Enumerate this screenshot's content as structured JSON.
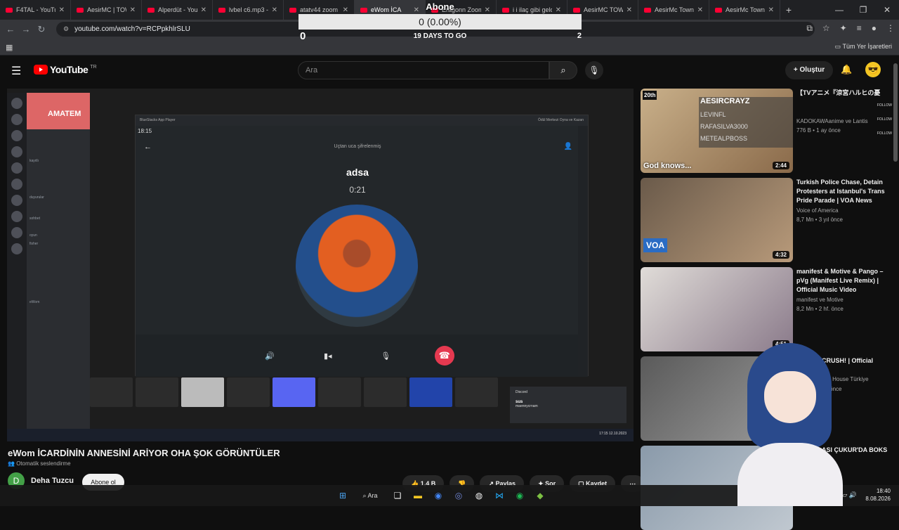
{
  "browser": {
    "tabs": [
      {
        "title": "F4TAL - YouTu"
      },
      {
        "title": "AesirMC | TOW"
      },
      {
        "title": "Alperdüt - You"
      },
      {
        "title": "lvbel c6.mp3 -"
      },
      {
        "title": "atatv44 zoom"
      },
      {
        "title": "eWom İCA"
      },
      {
        "title": "Eragonn Zoom"
      },
      {
        "title": "i i ilaç gibi gelo"
      },
      {
        "title": "AesirMC TOW"
      },
      {
        "title": "AesirMc Towny"
      },
      {
        "title": "AesirMc Towny"
      }
    ],
    "url": "youtube.com/watch?v=RCPpkhlrSLU",
    "bookmarks_label": "Tüm Yer İşaretleri"
  },
  "overlay": {
    "title": "Abone",
    "progress": "0 (0.00%)",
    "left_count": "0",
    "middle": "19 DAYS TO GO",
    "right_count": "2"
  },
  "youtube": {
    "brand": "YouTube",
    "region": "TR",
    "search_placeholder": "Ara",
    "create_label": "Oluştur"
  },
  "player": {
    "discord_banner": "AMATEM",
    "discord_channels": [
      "kayıtlı",
      "duyurular",
      "sohbet",
      "oyun",
      "fisher",
      "eWom"
    ],
    "bluestacks_title": "BlueStacks App Player",
    "bluestacks_right": "Ödül Merkezi   Oyna ve Kazan",
    "call_time": "18:15",
    "call_e2e": "Uçtan uca şifrelenmiş",
    "call_name": "adsa",
    "call_duration": "0:21",
    "toast_app": "Discord",
    "toast_title": "sus",
    "toast_sub": "maennycrnam",
    "clock": "17:15",
    "date": "12.10.2023"
  },
  "video": {
    "title": "eWom İCARDİNİN ANNESİNİ ARİYOR OHA ŞOK GÖRÜNTÜLER",
    "autodub": "Otomatik seslendirme",
    "channel_initial": "D",
    "channel": "Deha Tuzcu",
    "subscribe_label": "Abone ol",
    "likes": "1,4 B",
    "share_label": "Paylaş",
    "ask_label": "Sor",
    "save_label": "Kaydet"
  },
  "sidebar": {
    "cards": [
      {
        "title": "【TVアニメ『涼宮ハルヒの憂",
        "channel": "KADOKAWAanime ve Lantis",
        "meta": "776 B • 1 ay önce",
        "duration": "2:44",
        "thumb_caption": "God knows...",
        "badge": "20th"
      },
      {
        "title": "Turkish Police Chase, Detain Protesters at Istanbul's Trans Pride Parade | VOA News",
        "channel": "Voice of America",
        "meta": "8,7 Mn • 3 yıl önce",
        "duration": "4:32",
        "badge": "VOA"
      },
      {
        "title": "manifest & Motive & Pango – pVg (Manifest Live Remix) | Official Music Video",
        "channel": "manifest ve Motive",
        "meta": "8,2 Mn • 2 hf. önce",
        "duration": "4:51"
      },
      {
        "title": "CRUSH! | Official",
        "channel": "Idol House Türkiye",
        "meta": "ün önce",
        "duration": ""
      },
      {
        "title": "ASI ÇUKUR'DA BOKS",
        "channel": "",
        "meta": "",
        "duration": ""
      }
    ],
    "tts": {
      "header": "AESIRCRAYZ",
      "names": [
        "LEVINFL",
        "RAFASILVA3000",
        "METEALPBOSS"
      ],
      "follow": "FOLLOW"
    }
  },
  "taskbar": {
    "search": "Ara",
    "time": "18:40",
    "date": "8.08.2026"
  }
}
